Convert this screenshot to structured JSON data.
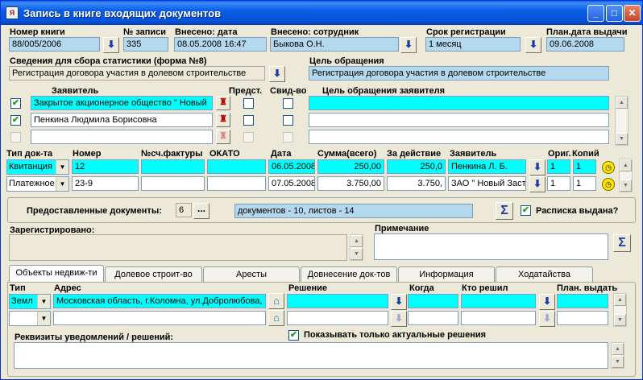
{
  "window": {
    "title": "Запись в книге входящих документов",
    "controls": {
      "minimize": "_",
      "maximize": "□",
      "close": "✕"
    }
  },
  "header": {
    "book_number_label": "Номер книги",
    "book_number_value": "88/005/2006",
    "record_no_label": "№ записи",
    "record_no_value": "335",
    "entered_date_label": "Внесено: дата",
    "entered_date_value": "08.05.2008 16:47",
    "entered_by_label": "Внесено: сотрудник",
    "entered_by_value": "Быкова О.Н.",
    "reg_term_label": "Срок регистрации",
    "reg_term_value": "1 месяц",
    "planned_date_label": "План.дата выдачи",
    "planned_date_value": "09.06.2008"
  },
  "stats": {
    "label": "Сведения для сбора статистики (форма №8)",
    "value": "Регистрация договора участия в долевом строительстве",
    "purpose_label": "Цель обращения",
    "purpose_value": "Регистрация договора участия в долевом строительстве"
  },
  "applicants": {
    "col_applicant": "Заявитель",
    "col_repr": "Предст.",
    "col_cert": "Свид-во",
    "col_purpose": "Цель обращения заявителя",
    "rows": [
      {
        "checked": "✔",
        "name": "Закрытое акционерное общество \" Новый "
      },
      {
        "checked": "✔",
        "name": "Пенкина Людмила Борисовна"
      },
      {
        "checked": "",
        "name": ""
      }
    ]
  },
  "docs": {
    "headers": {
      "type": "Тип док-та",
      "number": "Номер",
      "invoice": "№сч.фактуры",
      "okato": "ОКАТО",
      "date": "Дата",
      "sum": "Сумма(всего)",
      "action": "За действие",
      "applicant": "Заявитель",
      "orig": "Ориг.",
      "copies": "Копий"
    },
    "rows": [
      {
        "type": "Квитанция",
        "number": "12",
        "invoice": "",
        "okato": "",
        "date": "06.05.2008",
        "sum": "250,00",
        "action": "250,0",
        "applicant": "Пенкина Л. Б.",
        "orig": "1",
        "copies": "1"
      },
      {
        "type": "Платежное",
        "number": "23-9",
        "invoice": "",
        "okato": "",
        "date": "07.05.2008",
        "sum": "3.750,00",
        "action": "3.750,",
        "applicant": "ЗАО \" Новый Застр",
        "orig": "1",
        "copies": "1"
      }
    ]
  },
  "provided": {
    "label": "Предоставленные документы:",
    "count": "6",
    "more": "...",
    "summary": "документов - 10, листов - 14",
    "receipt_check": "✔",
    "receipt_label": "Расписка выдана?"
  },
  "registered_label": "Зарегистрировано:",
  "note_label": "Примечание",
  "tabs": [
    "Объекты недвиж-ти",
    "Долевое строит-во",
    "Аресты",
    "Довнесение док-тов",
    "Информация",
    "Ходатайства"
  ],
  "objects": {
    "col_type": "Тип",
    "col_address": "Адрес",
    "col_decision": "Решение",
    "col_when": "Когда",
    "col_who": "Кто решил",
    "col_plan": "План. выдать",
    "rows": [
      {
        "type": "Земл",
        "address": "Московская область, г.Коломна, ул.Добролюбова,"
      },
      {
        "type": "",
        "address": ""
      }
    ],
    "only_actual_check": "✔",
    "only_actual_label": "Показывать только актуальные решения",
    "notice_label": "Реквизиты уведомлений / решений:"
  },
  "glyphs": {
    "dropdown": "⬇",
    "arrow_small": "▼",
    "sigma": "Σ",
    "up": "▲",
    "down": "▼",
    "house": "⌂",
    "person": "♜",
    "clock": "◷"
  }
}
